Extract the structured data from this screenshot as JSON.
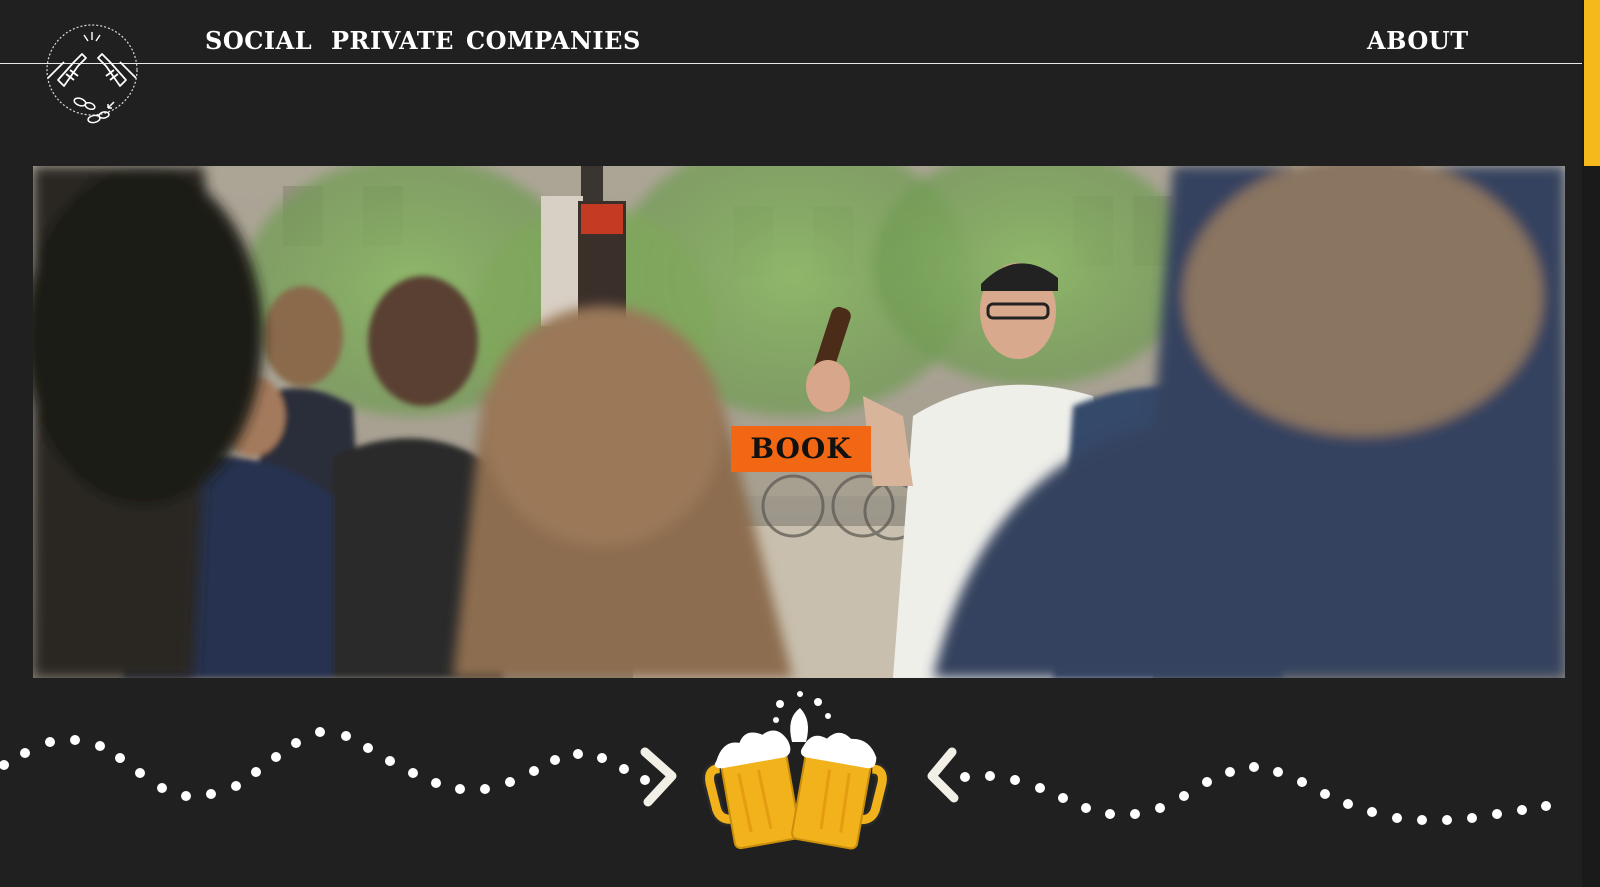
{
  "header": {
    "logo_name": "crossed-bottles-logo",
    "nav": {
      "social": "SOCIAL",
      "private": "PRIVATE",
      "companies": "COMPANIES",
      "about": "ABOUT"
    }
  },
  "hero": {
    "scene": "crowd-tour-guide-photo",
    "book_label": "BOOK"
  },
  "divider": {
    "icon": "cheers-beer-mugs-icon",
    "left_arrow": "arrow-right-icon",
    "right_arrow": "arrow-left-icon"
  },
  "colors": {
    "background": "#202020",
    "accent": "#f26714",
    "beer": "#f5b91b",
    "scrollbar": "#f5b91b",
    "text": "#ffffff"
  }
}
